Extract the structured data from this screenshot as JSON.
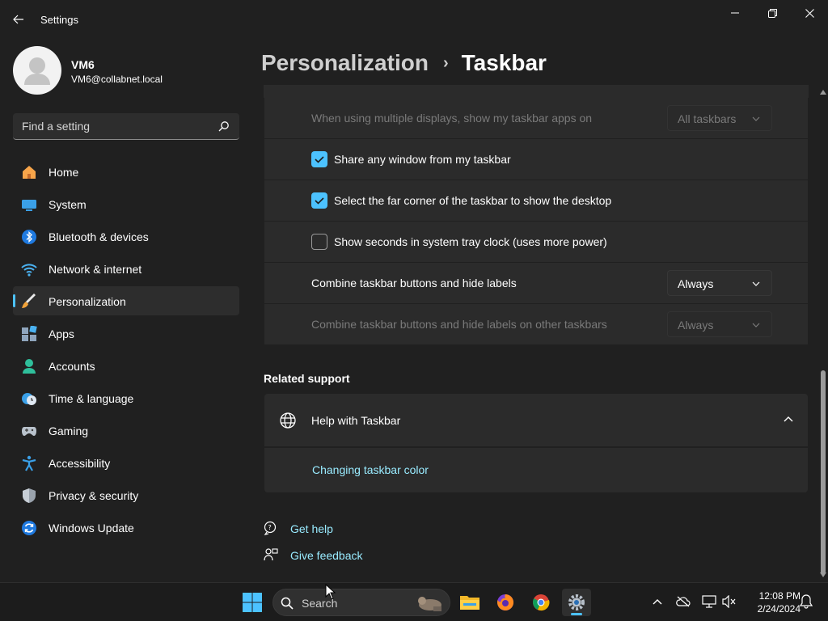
{
  "window": {
    "app_title": "Settings",
    "controls": [
      "minimize",
      "maximize",
      "close"
    ]
  },
  "profile": {
    "name": "VM6",
    "email": "VM6@collabnet.local"
  },
  "search": {
    "placeholder": "Find a setting"
  },
  "sidebar": {
    "items": [
      {
        "label": "Home",
        "icon": "home-icon"
      },
      {
        "label": "System",
        "icon": "system-icon"
      },
      {
        "label": "Bluetooth & devices",
        "icon": "bluetooth-icon"
      },
      {
        "label": "Network & internet",
        "icon": "wifi-icon"
      },
      {
        "label": "Personalization",
        "icon": "brush-icon",
        "active": true
      },
      {
        "label": "Apps",
        "icon": "apps-icon"
      },
      {
        "label": "Accounts",
        "icon": "accounts-icon"
      },
      {
        "label": "Time & language",
        "icon": "time-language-icon"
      },
      {
        "label": "Gaming",
        "icon": "gamepad-icon"
      },
      {
        "label": "Accessibility",
        "icon": "accessibility-icon"
      },
      {
        "label": "Privacy & security",
        "icon": "shield-icon"
      },
      {
        "label": "Windows Update",
        "icon": "update-icon"
      }
    ]
  },
  "breadcrumb": {
    "parent": "Personalization",
    "separator": "›",
    "current": "Taskbar"
  },
  "settings": {
    "multi_display": {
      "label": "When using multiple displays, show my taskbar apps on",
      "value": "All taskbars",
      "disabled": true
    },
    "share_window": {
      "label": "Share any window from my taskbar",
      "checked": true
    },
    "far_corner": {
      "label": "Select the far corner of the taskbar to show the desktop",
      "checked": true
    },
    "show_seconds": {
      "label": "Show seconds in system tray clock (uses more power)",
      "checked": false
    },
    "combine_buttons": {
      "label": "Combine taskbar buttons and hide labels",
      "value": "Always"
    },
    "combine_other": {
      "label": "Combine taskbar buttons and hide labels on other taskbars",
      "value": "Always",
      "disabled": true
    }
  },
  "related_support": {
    "title": "Related support",
    "help_title": "Help with Taskbar",
    "link": "Changing taskbar color"
  },
  "footer": {
    "get_help": "Get help",
    "give_feedback": "Give feedback"
  },
  "taskbar": {
    "search_label": "Search",
    "apps": [
      "file-explorer-icon",
      "firefox-icon",
      "chrome-icon",
      "settings-icon"
    ],
    "active_app": "settings-icon",
    "time": "12:08 PM",
    "date": "2/24/2024"
  },
  "colors": {
    "accent": "#4cc2ff",
    "link": "#99ebff",
    "background": "#202020",
    "card": "#2b2b2b"
  }
}
